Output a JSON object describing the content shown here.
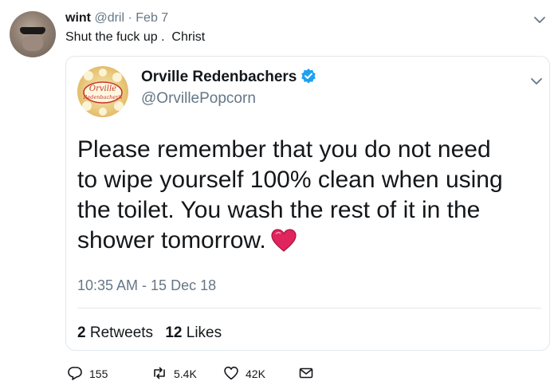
{
  "outer_tweet": {
    "author_name": "wint",
    "handle": "@dril",
    "separator": "·",
    "date": "Feb 7",
    "text": "Shut the fuck up .  Christ"
  },
  "quoted_tweet": {
    "author_name": "Orville Redenbachers",
    "handle": "@OrvillePopcorn",
    "avatar_logo_text": [
      "Orville",
      "Redenbacher's"
    ],
    "body_lines": [
      "Please remember that you do not need",
      "to wipe yourself 100% clean when using",
      "the toilet. You wash the rest of it in the",
      "shower tomorrow."
    ],
    "timestamp": "10:35 AM - 15 Dec 18",
    "retweets_count": "2",
    "retweets_label": "Retweets",
    "likes_count": "12",
    "likes_label": "Likes"
  },
  "actions": {
    "replies": "155",
    "retweets": "5.4K",
    "likes": "42K"
  },
  "icons": {
    "reply": "reply-icon",
    "retweet": "retweet-icon",
    "like": "heart-icon",
    "dm": "envelope-icon",
    "verified": "verified-badge-icon",
    "chevron": "chevron-down-icon",
    "emoji": "red-heart-emoji"
  },
  "colors": {
    "text": "#14171a",
    "muted": "#657786",
    "verified_blue": "#1da1f2",
    "heart_red": "#e0245e",
    "border": "#e1e8ed"
  }
}
